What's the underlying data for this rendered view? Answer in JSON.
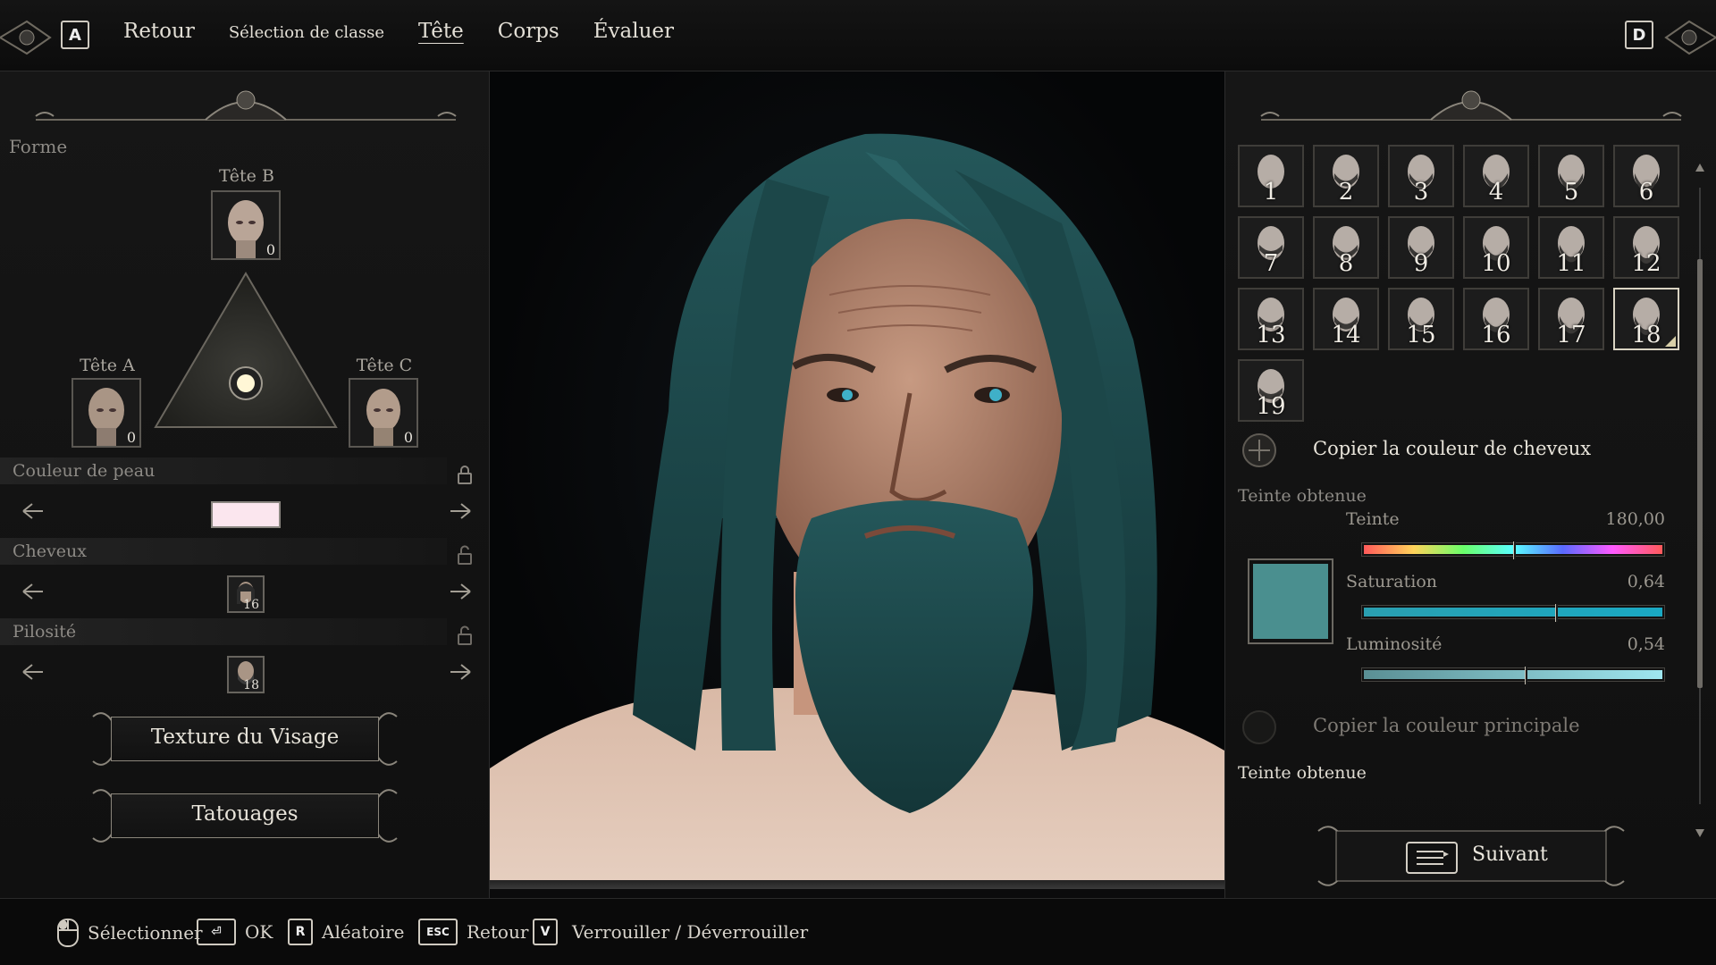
{
  "topbar": {
    "key_left": "A",
    "key_right": "D",
    "nav": [
      {
        "label": "Retour",
        "active": false,
        "small": false
      },
      {
        "label": "Sélection de classe",
        "active": false,
        "small": true
      },
      {
        "label": "Tête",
        "active": true,
        "small": false
      },
      {
        "label": "Corps",
        "active": false,
        "small": false
      },
      {
        "label": "Évaluer",
        "active": false,
        "small": false
      }
    ]
  },
  "left": {
    "forme_label": "Forme",
    "head_b": {
      "label": "Tête B",
      "value": "0"
    },
    "head_a": {
      "label": "Tête A",
      "value": "0"
    },
    "head_c": {
      "label": "Tête C",
      "value": "0"
    },
    "skin_label": "Couleur de peau",
    "skin_color": "#fbe6ee",
    "hair_label": "Cheveux",
    "hair_value": "16",
    "beard_label": "Pilosité",
    "beard_value": "18",
    "btn_texture": "Texture du Visage",
    "btn_tattoo": "Tatouages"
  },
  "right": {
    "grid": [
      "1",
      "2",
      "3",
      "4",
      "5",
      "6",
      "7",
      "8",
      "9",
      "10",
      "11",
      "12",
      "13",
      "14",
      "15",
      "16",
      "17",
      "18",
      "19"
    ],
    "selected": "18",
    "copy_hair": "Copier la couleur de cheveux",
    "tint_label": "Teinte obtenue",
    "hue_label": "Teinte",
    "hue_value": "180,00",
    "hue_fraction": 0.5,
    "sat_label": "Saturation",
    "sat_value": "0,64",
    "sat_fraction": 0.64,
    "lum_label": "Luminosité",
    "lum_value": "0,54",
    "lum_fraction": 0.54,
    "preview_color": "#4a8f8f",
    "copy_main": "Copier la couleur principale",
    "tint_label2": "Teinte obtenue",
    "next_label": "Suivant"
  },
  "bottom": {
    "select": "Sélectionner",
    "ok_key": "⏎",
    "ok": "OK",
    "random_key": "R",
    "random": "Aléatoire",
    "esc_key": "ESC",
    "back": "Retour",
    "lock_key": "V",
    "lock": "Verrouiller / Déverrouiller"
  },
  "colors": {
    "hair": "#1d4a4c",
    "skin": "#b78570",
    "eyes": "#3fb0c8"
  }
}
